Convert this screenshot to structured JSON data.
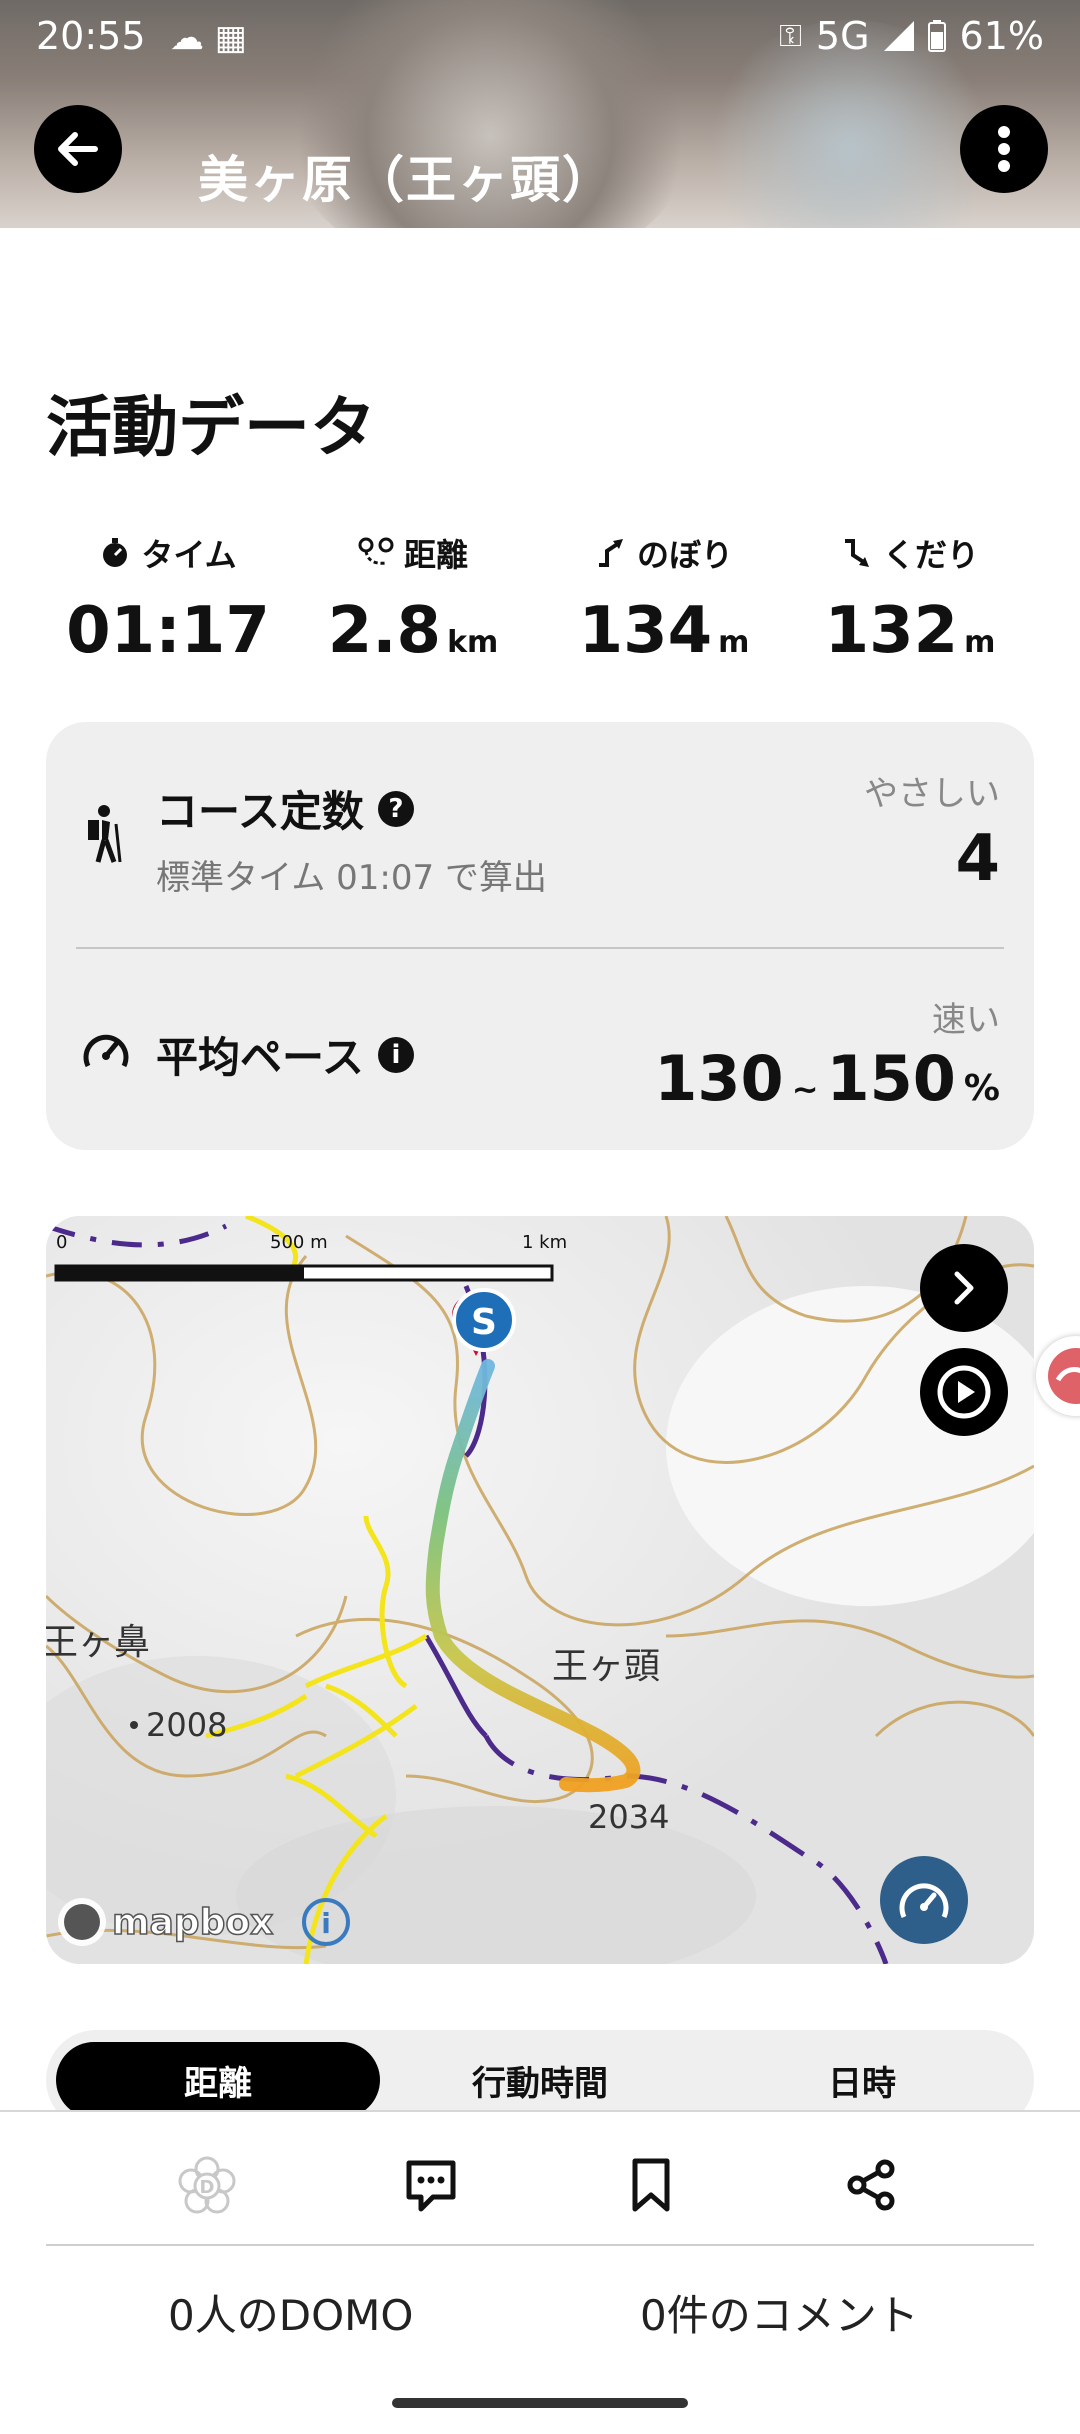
{
  "status_bar": {
    "time": "20:55",
    "network": "5G",
    "battery": "61%"
  },
  "header": {
    "title": "美ヶ原（王ヶ頭）"
  },
  "activity": {
    "section_title": "活動データ",
    "stats": [
      {
        "label": "タイム",
        "value": "01:17",
        "unit": "",
        "icon": "stopwatch-icon"
      },
      {
        "label": "距離",
        "value": "2.8",
        "unit": "km",
        "icon": "route-icon"
      },
      {
        "label": "のぼり",
        "value": "134",
        "unit": "m",
        "icon": "ascent-icon"
      },
      {
        "label": "くだり",
        "value": "132",
        "unit": "m",
        "icon": "descent-icon"
      }
    ]
  },
  "course": {
    "title": "コース定数",
    "subtitle": "標準タイム 01:07 で算出",
    "level": "やさしい",
    "value": "4"
  },
  "pace": {
    "title": "平均ペース",
    "speed_label": "速い",
    "min": "130",
    "max": "150",
    "tilde": "~",
    "unit": "%"
  },
  "map": {
    "scale": {
      "zero": "0",
      "mid": "500 m",
      "max": "1 km"
    },
    "labels": {
      "peak_name": "王ヶ頭",
      "left_peak": "王ヶ鼻",
      "elev_left": "2008",
      "elev_right": "2034"
    },
    "start_marker": "S",
    "attribution": "mapbox",
    "info_symbol": "i"
  },
  "tabs": {
    "items": [
      "距離",
      "行動時間",
      "日時"
    ],
    "active": "距離"
  },
  "footer": {
    "domo_count": "0人のDOMO",
    "comment_count": "0件のコメント"
  },
  "colors": {
    "accent_blue": "#2e5f8a",
    "marker_red": "#c8102e",
    "marker_blue": "#1f6fb8"
  }
}
